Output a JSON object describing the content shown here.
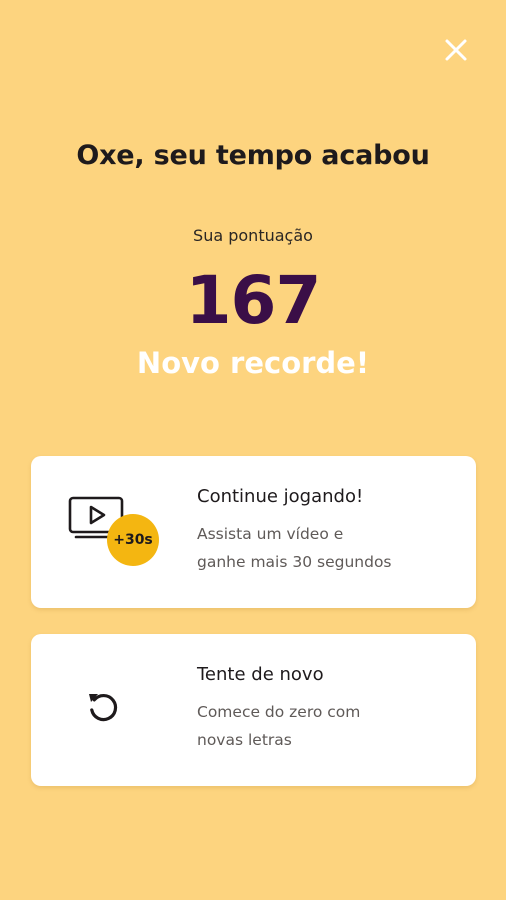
{
  "close": {
    "icon": "close-icon"
  },
  "title": "Oxe, seu tempo acabou",
  "score": {
    "label": "Sua pontuação",
    "value": "167",
    "record": "Novo recorde!"
  },
  "options": {
    "continue": {
      "title": "Continue jogando!",
      "line1": "Assista um vídeo e",
      "line2": "ganhe mais 30 segundos",
      "badge": "+30s",
      "icon": "video-play-icon"
    },
    "retry": {
      "title": "Tente de novo",
      "line1": "Comece do zero com",
      "line2": "novas letras",
      "icon": "restart-icon"
    }
  },
  "colors": {
    "background": "#FDD47F",
    "score": "#3A0E47",
    "badge": "#F4B611",
    "card": "#FFFFFF"
  }
}
